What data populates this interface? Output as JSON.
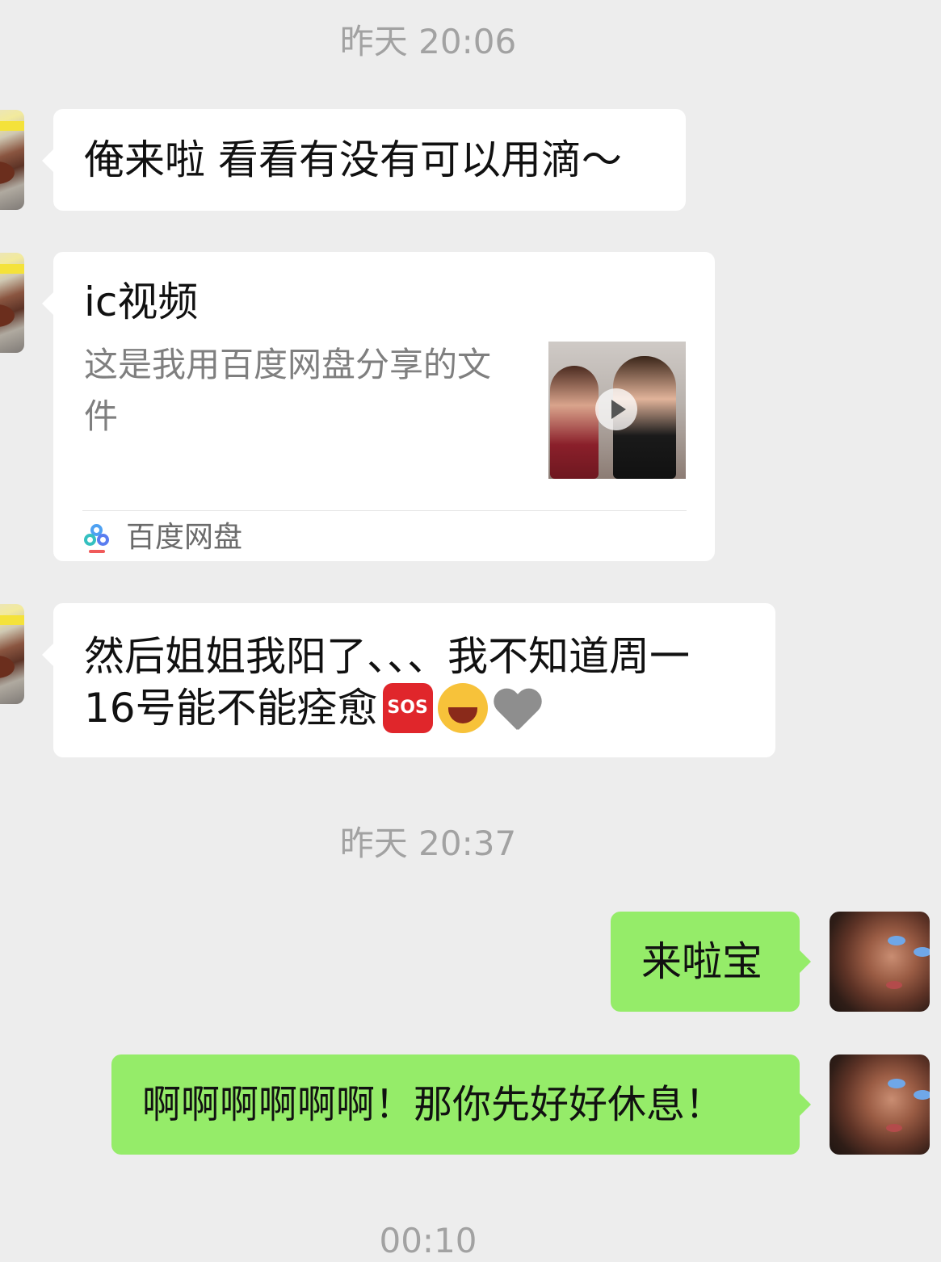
{
  "timestamps": [
    "昨天 20:06",
    "昨天 20:37",
    "00:10"
  ],
  "messages": {
    "m1": "俺来啦 看看有没有可以用滴～",
    "card": {
      "title": "ic视频",
      "description": "这是我用百度网盘分享的文件",
      "source": "百度网盘"
    },
    "m3_line1": "然后姐姐我阳了、、、我不知道周一",
    "m3_line2": "16号能不能痊愈",
    "m3_emoji": [
      "sos-icon",
      "laughing-tears-icon",
      "broken-heart-icon"
    ],
    "sos_label": "SOS",
    "r1": "来啦宝",
    "r2": "啊啊啊啊啊啊！那你先好好休息！"
  },
  "colors": {
    "background": "#ededed",
    "incoming_bubble": "#ffffff",
    "outgoing_bubble": "#95ec69",
    "timestamp": "#a2a2a2"
  }
}
